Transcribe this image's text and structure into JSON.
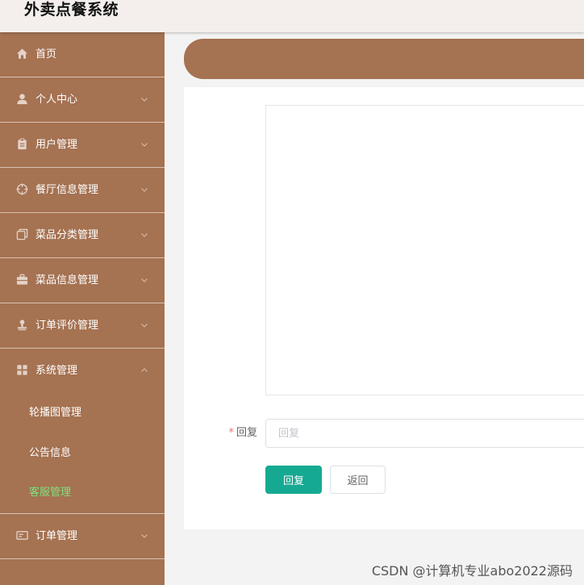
{
  "header": {
    "title": "外卖点餐系统"
  },
  "sidebar": {
    "items": [
      {
        "label": "首页",
        "icon": "home-icon",
        "expandable": false
      },
      {
        "label": "个人中心",
        "icon": "user-icon",
        "expandable": true
      },
      {
        "label": "用户管理",
        "icon": "clipboard-icon",
        "expandable": true
      },
      {
        "label": "餐厅信息管理",
        "icon": "crosshair-icon",
        "expandable": true
      },
      {
        "label": "菜品分类管理",
        "icon": "copy-icon",
        "expandable": true
      },
      {
        "label": "菜品信息管理",
        "icon": "briefcase-icon",
        "expandable": true
      },
      {
        "label": "订单评价管理",
        "icon": "stamp-icon",
        "expandable": true
      },
      {
        "label": "系统管理",
        "icon": "grid-icon",
        "expandable": true,
        "expanded": true
      },
      {
        "label": "订单管理",
        "icon": "ticket-icon",
        "expandable": true
      }
    ],
    "system_submenu": [
      {
        "label": "轮播图管理",
        "active": false
      },
      {
        "label": "公告信息",
        "active": false
      },
      {
        "label": "客服管理",
        "active": true
      }
    ]
  },
  "form": {
    "reply_label": "回复",
    "required_mark": "*",
    "reply_value": "",
    "reply_placeholder": "回复",
    "submit_label": "回复",
    "back_label": "返回"
  },
  "watermark": "CSDN @计算机专业abo2022源码",
  "colors": {
    "sidebar_bg": "#a57252",
    "primary_button": "#16a992",
    "active_submenu": "#7fe07f",
    "required": "#f56c6c"
  }
}
